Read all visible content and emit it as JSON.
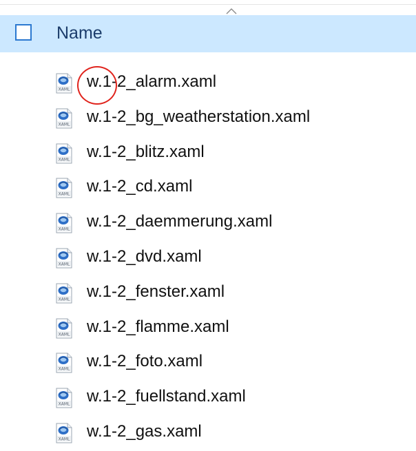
{
  "header": {
    "label": "Name"
  },
  "files": [
    {
      "name": "w.1-2_alarm.xaml",
      "icon": "xaml-file-icon"
    },
    {
      "name": "w.1-2_bg_weatherstation.xaml",
      "icon": "xaml-file-icon"
    },
    {
      "name": "w.1-2_blitz.xaml",
      "icon": "xaml-file-icon"
    },
    {
      "name": "w.1-2_cd.xaml",
      "icon": "xaml-file-icon"
    },
    {
      "name": "w.1-2_daemmerung.xaml",
      "icon": "xaml-file-icon"
    },
    {
      "name": "w.1-2_dvd.xaml",
      "icon": "xaml-file-icon"
    },
    {
      "name": "w.1-2_fenster.xaml",
      "icon": "xaml-file-icon"
    },
    {
      "name": "w.1-2_flamme.xaml",
      "icon": "xaml-file-icon"
    },
    {
      "name": "w.1-2_foto.xaml",
      "icon": "xaml-file-icon"
    },
    {
      "name": "w.1-2_fuellstand.xaml",
      "icon": "xaml-file-icon"
    },
    {
      "name": "w.1-2_gas.xaml",
      "icon": "xaml-file-icon"
    }
  ],
  "icon_label": "XAML",
  "colors": {
    "header_bg": "#cce8ff",
    "checkbox_border": "#2b78d0",
    "annotation": "#e0231c"
  }
}
